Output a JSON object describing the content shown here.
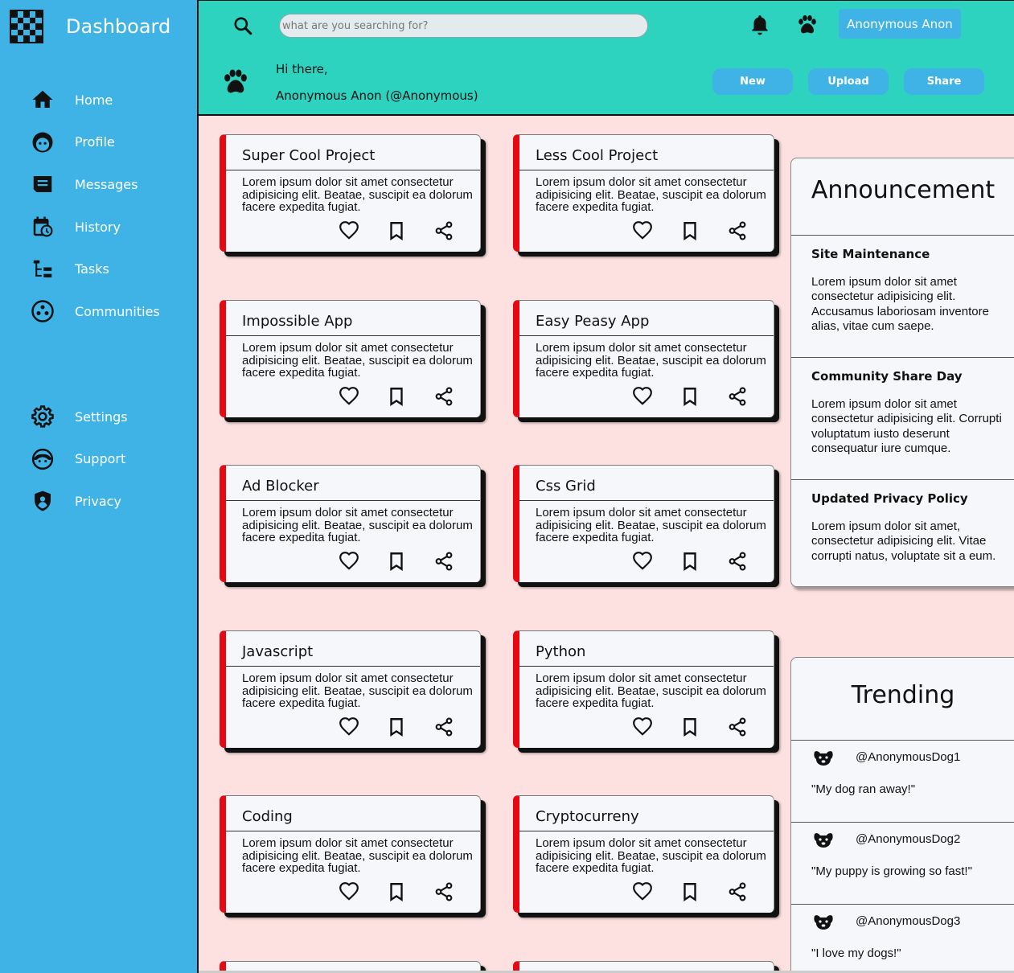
{
  "app": {
    "title": "Dashboard"
  },
  "sidebar": {
    "items": [
      {
        "label": "Home",
        "icon": "home-icon"
      },
      {
        "label": "Profile",
        "icon": "profile-icon"
      },
      {
        "label": "Messages",
        "icon": "messages-icon"
      },
      {
        "label": "History",
        "icon": "history-icon"
      },
      {
        "label": "Tasks",
        "icon": "tasks-icon"
      },
      {
        "label": "Communities",
        "icon": "communities-icon"
      }
    ],
    "bottom_items": [
      {
        "label": "Settings",
        "icon": "gear-icon"
      },
      {
        "label": "Support",
        "icon": "support-icon"
      },
      {
        "label": "Privacy",
        "icon": "shield-icon"
      }
    ]
  },
  "header": {
    "search_placeholder": "what are you searching for?",
    "user_button": "Anonymous Anon",
    "greeting": "Hi there,",
    "user_display": "Anonymous Anon (@Anonymous)",
    "buttons": {
      "new": "New",
      "upload": "Upload",
      "share": "Share"
    }
  },
  "cards": [
    {
      "title": "Super Cool Project",
      "text": "Lorem ipsum dolor sit amet consectetur adipisicing elit. Beatae, suscipit ea dolorum facere expedita fugiat."
    },
    {
      "title": "Less Cool Project",
      "text": "Lorem ipsum dolor sit amet consectetur adipisicing elit. Beatae, suscipit ea dolorum facere expedita fugiat."
    },
    {
      "title": "Impossible App",
      "text": "Lorem ipsum dolor sit amet consectetur adipisicing elit. Beatae, suscipit ea dolorum facere expedita fugiat."
    },
    {
      "title": "Easy Peasy App",
      "text": "Lorem ipsum dolor sit amet consectetur adipisicing elit. Beatae, suscipit ea dolorum facere expedita fugiat."
    },
    {
      "title": "Ad Blocker",
      "text": "Lorem ipsum dolor sit amet consectetur adipisicing elit. Beatae, suscipit ea dolorum facere expedita fugiat."
    },
    {
      "title": "Css Grid",
      "text": "Lorem ipsum dolor sit amet consectetur adipisicing elit. Beatae, suscipit ea dolorum facere expedita fugiat."
    },
    {
      "title": "Javascript",
      "text": "Lorem ipsum dolor sit amet consectetur adipisicing elit. Beatae, suscipit ea dolorum facere expedita fugiat."
    },
    {
      "title": "Python",
      "text": "Lorem ipsum dolor sit amet consectetur adipisicing elit. Beatae, suscipit ea dolorum facere expedita fugiat."
    },
    {
      "title": "Coding",
      "text": "Lorem ipsum dolor sit amet consectetur adipisicing elit. Beatae, suscipit ea dolorum facere expedita fugiat."
    },
    {
      "title": "Cryptocurreny",
      "text": "Lorem ipsum dolor sit amet consectetur adipisicing elit. Beatae, suscipit ea dolorum facere expedita fugiat."
    }
  ],
  "announcement": {
    "title": "Announcement",
    "items": [
      {
        "heading": "Site Maintenance",
        "text": "Lorem ipsum dolor sit amet consectetur adipisicing elit. Accusamus laboriosam inventore alias, vitae cum saepe."
      },
      {
        "heading": "Community Share Day",
        "text": "Lorem ipsum dolor sit amet consectetur adipisicing elit. Corrupti voluptatum iusto deserunt consequatur iure cumque."
      },
      {
        "heading": "Updated Privacy Policy",
        "text": "Lorem ipsum dolor sit amet, consectetur adipisicing elit. Vitae corrupti natus, voluptate sit a eum."
      }
    ]
  },
  "trending": {
    "title": "Trending",
    "items": [
      {
        "handle": "@AnonymousDog1",
        "quote": "\"My dog ran away!\""
      },
      {
        "handle": "@AnonymousDog2",
        "quote": "\"My puppy is growing so fast!\""
      },
      {
        "handle": "@AnonymousDog3",
        "quote": "\"I love my dogs!\""
      }
    ]
  },
  "colors": {
    "sidebar": "#3fb3e6",
    "header": "#2ed3bf",
    "content_bg": "#fde1e1",
    "card_accent": "#e50914"
  }
}
